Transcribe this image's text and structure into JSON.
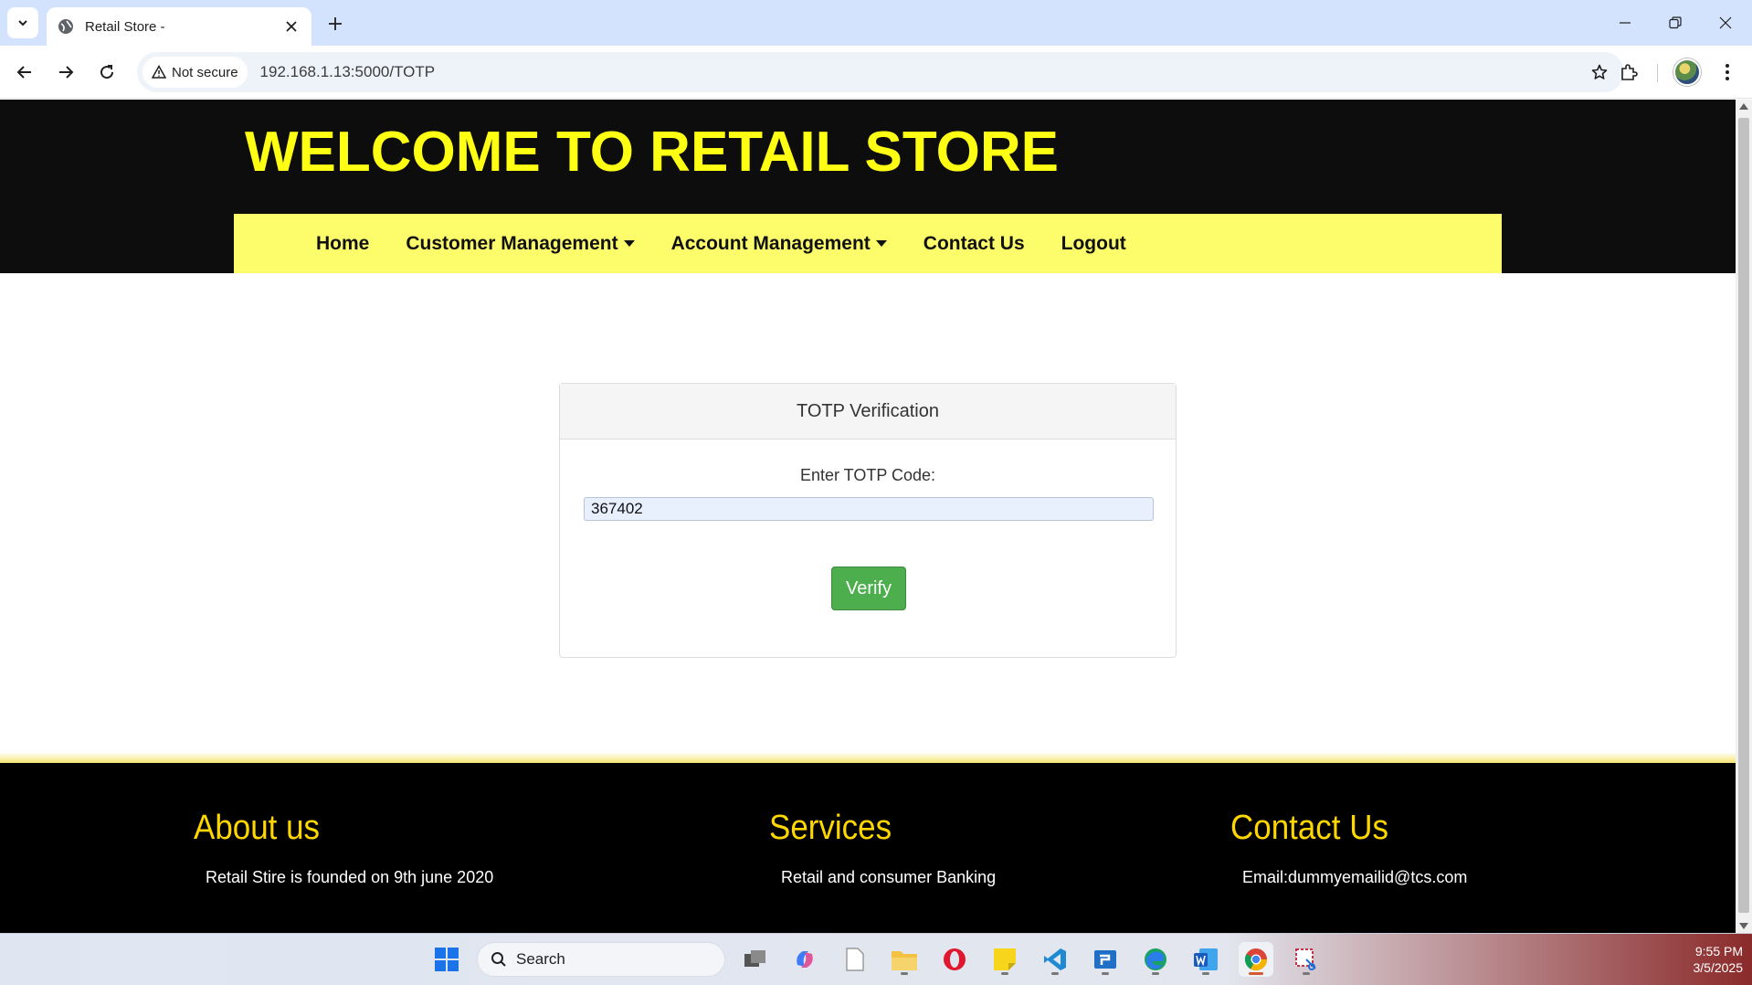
{
  "browser": {
    "tab_title": "Retail Store -",
    "security_label": "Not secure",
    "url": "192.168.1.13:5000/TOTP"
  },
  "site": {
    "title": "WELCOME TO RETAIL STORE",
    "nav": {
      "home": "Home",
      "customer_management": "Customer Management",
      "account_management": "Account Management",
      "contact_us": "Contact Us",
      "logout": "Logout"
    }
  },
  "totp": {
    "header": "TOTP Verification",
    "label": "Enter TOTP Code:",
    "code_value": "367402",
    "verify_label": "Verify"
  },
  "footer": {
    "about": {
      "heading": "About us",
      "line1": "Retail Stire is founded on 9th june 2020"
    },
    "services": {
      "heading": "Services",
      "line1": "Retail and consumer Banking"
    },
    "contact": {
      "heading": "Contact Us",
      "line1": "Email:dummyemailid@tcs.com"
    }
  },
  "taskbar": {
    "search_label": "Search",
    "time": "9:55 PM",
    "date": "3/5/2025"
  },
  "colors": {
    "header_bg": "#0d0d0d",
    "title_yellow": "#ffff14",
    "nav_bg": "#fdfd6c",
    "verify_green": "#4cae4c",
    "footer_heading": "#ffd700"
  }
}
